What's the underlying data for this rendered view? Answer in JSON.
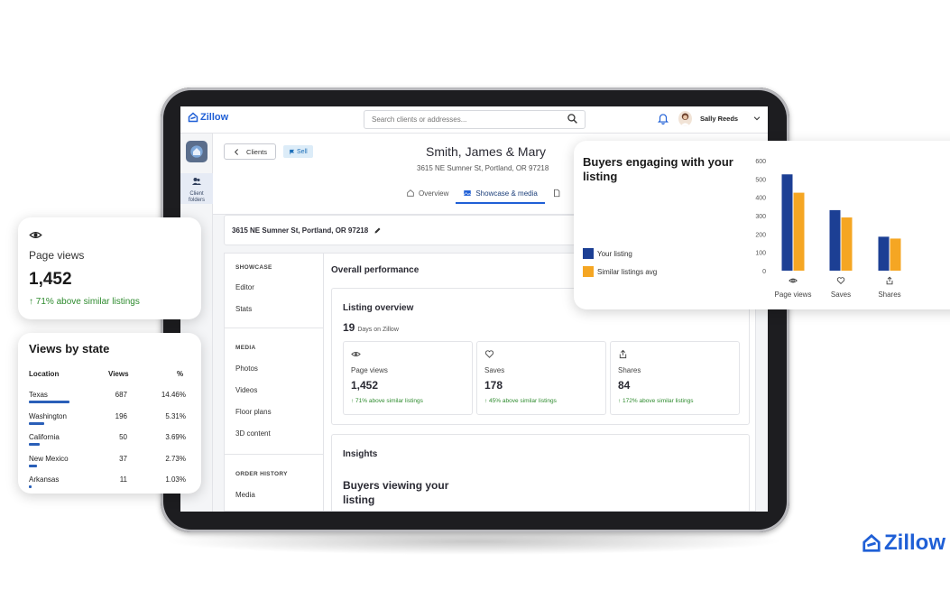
{
  "app": {
    "logo_text": "Zillow",
    "search_placeholder": "Search clients or addresses...",
    "user_name": "Sally Reeds"
  },
  "rail": {
    "client_folders_label_1": "Client",
    "client_folders_label_2": "folders"
  },
  "subheader": {
    "back_label": "Clients",
    "badge_label": "Sell",
    "client_name": "Smith, James & Mary",
    "client_address": "3615 NE Sumner St, Portland, OR 97218",
    "tabs": [
      {
        "label": "Overview",
        "active": false
      },
      {
        "label": "Showcase & media",
        "active": true
      }
    ]
  },
  "address_card": {
    "address": "3615 NE Sumner St, Portland, OR 97218"
  },
  "side_menu": {
    "groups": [
      {
        "title": "SHOWCASE",
        "items": [
          "Editor",
          "Stats"
        ]
      },
      {
        "title": "MEDIA",
        "items": [
          "Photos",
          "Videos",
          "Floor plans",
          "3D content"
        ]
      },
      {
        "title": "ORDER HISTORY",
        "items": [
          "Media"
        ]
      }
    ]
  },
  "main": {
    "overall_title": "Overall performance",
    "listing_overview_title": "Listing overview",
    "days_value": "19",
    "days_label": "Days on Zillow",
    "metrics": [
      {
        "icon": "eye-icon",
        "label": "Page views",
        "value": "1,452",
        "trend": "↑ 71% above similar listings"
      },
      {
        "icon": "heart-icon",
        "label": "Saves",
        "value": "178",
        "trend": "↑ 45% above similar listings"
      },
      {
        "icon": "share-icon",
        "label": "Shares",
        "value": "84",
        "trend": "↑ 172% above similar listings"
      }
    ],
    "insights_title": "Insights",
    "insights_subtitle": "Buyers viewing your listing"
  },
  "page_views_card": {
    "label": "Page views",
    "value": "1,452",
    "trend": "↑ 71% above similar listings"
  },
  "views_by_state": {
    "title": "Views by state",
    "headers": {
      "location": "Location",
      "views": "Views",
      "pct": "%"
    },
    "rows": [
      {
        "location": "Texas",
        "views": "687",
        "pct": "14.46%",
        "share": 1.0
      },
      {
        "location": "Washington",
        "views": "196",
        "pct": "5.31%",
        "share": 0.37
      },
      {
        "location": "California",
        "views": "50",
        "pct": "3.69%",
        "share": 0.26
      },
      {
        "location": "New Mexico",
        "views": "37",
        "pct": "2.73%",
        "share": 0.19
      },
      {
        "location": "Arkansas",
        "views": "11",
        "pct": "1.03%",
        "share": 0.07
      }
    ]
  },
  "engagement_card": {
    "title": "Buyers engaging with your listing",
    "legend": [
      {
        "label": "Your listing",
        "color": "#1c3f94"
      },
      {
        "label": "Similar listings avg",
        "color": "#f5a623"
      }
    ]
  },
  "chart_data": {
    "type": "bar",
    "categories": [
      "Page views",
      "Saves",
      "Shares"
    ],
    "series": [
      {
        "name": "Your listing",
        "color": "#1c3f94",
        "values": [
          525,
          330,
          185
        ]
      },
      {
        "name": "Similar listings avg",
        "color": "#f5a623",
        "values": [
          425,
          290,
          175
        ]
      }
    ],
    "yticks": [
      "600",
      "500",
      "400",
      "300",
      "200",
      "100",
      "0"
    ],
    "ylim": [
      0,
      600
    ],
    "title": "Buyers engaging with your listing",
    "legend_position": "left"
  },
  "brand": {
    "text": "Zillow",
    "color": "#1f5fd6"
  }
}
